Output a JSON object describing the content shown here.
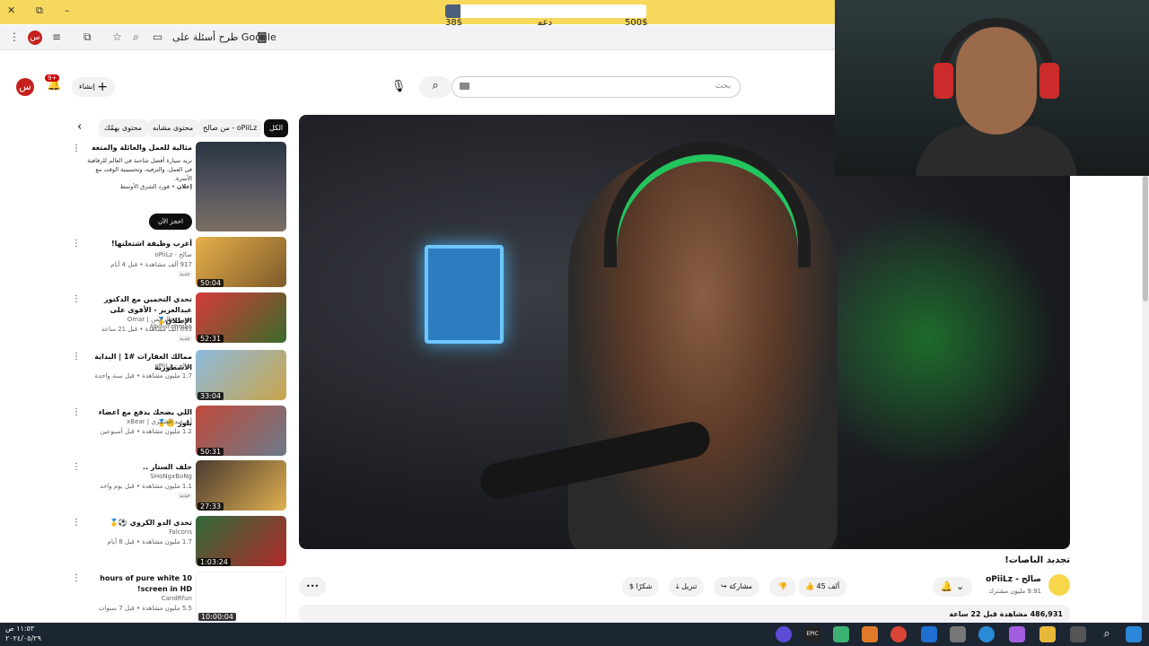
{
  "overlay": {
    "donation": {
      "current": "38$",
      "label": "دعم",
      "goal": "500$",
      "progress": 0.076
    },
    "window_controls": {
      "close": "✕",
      "restore": "⧉",
      "minimize": "–"
    }
  },
  "browser": {
    "search_google": "طرح أسئلة على Google",
    "profile_initial": "س",
    "icons": [
      "menu-dots-icon",
      "reading-list-icon",
      "extensions-icon",
      "star-icon",
      "zoom-icon",
      "install-icon",
      "camera-icon"
    ]
  },
  "youtube": {
    "search_placeholder": "بحث",
    "create_label": "إنشاء",
    "notification_badge": "9+",
    "avatar_initial": "س",
    "chips": [
      "الكل",
      "من صالح - oPiiLz",
      "محتوى مشابه",
      "محتوى يهمّك"
    ],
    "ad": {
      "title": "مثالية للعمل والعائلة والمتعة",
      "description": "تريد سيارة أفضل شاحنة في العالم للرفاهية في العمل، والترفيه، وتحسينية الوقت مع الأسرة.",
      "sponsor_tag": "إعلان",
      "sponsor": "فورد الشرق الأوسط",
      "cta": "احجز الآن"
    },
    "recommendations": [
      {
        "title": "أغرب وظيفة اشتغلتها!",
        "channel": "صالح - oPiiLz",
        "meta": "917 ألف مشاهدة • قبل 4 أيام",
        "new": "جديد",
        "duration": "50:04"
      },
      {
        "title": "تحدي التخمين مع الدكتور عبدالعزيز - الأقوى على الإطلاق🥇",
        "channel": "عمر عبدالرحمن | Omar Abdulrahman",
        "meta": "693 ألف مشاهدة • قبل 21 ساعة",
        "new": "جديد",
        "duration": "52:31"
      },
      {
        "title": "ممالك العقارات #1 | البداية الاسطورية",
        "channel": "صالح - oPiiLz",
        "meta": "1.7 مليون مشاهدة • قبل سنة واحدة",
        "new": "",
        "duration": "33:04"
      },
      {
        "title": "اللي يضحك يدفع مع اعضاء بلور 🤫🥇",
        "channel": "أبو عبد الشمري | xBear",
        "meta": "1.2 مليون مشاهدة • قبل أسبوعين",
        "new": "",
        "duration": "50:31"
      },
      {
        "title": "خلف الستار ..",
        "channel": "SHoNgxBoNg",
        "meta": "1.1 مليون مشاهدة • قبل يوم واحد",
        "new": "جديد",
        "duration": "27:33"
      },
      {
        "title": "تحدي الدو الكروي ⚽🥇",
        "channel": "Falcons",
        "meta": "1.7 مليون مشاهدة • قبل 8 أيام",
        "new": "",
        "duration": "1:03:24"
      },
      {
        "title": "10 hours of pure white screen in HD!",
        "channel": "CandRfun",
        "meta": "5.5 مليون مشاهدة • قبل 7 سنوات",
        "new": "",
        "duration": "10:00:04"
      }
    ],
    "video": {
      "title": "تجديد الباصات!",
      "channel": "صالح - oPiiLz",
      "subscribers": "9.91 مليون مشترك",
      "likes": "45 ألف",
      "share": "مشاركة",
      "download": "تنزيل",
      "thanks": "شكرًا",
      "more": "•••",
      "views": "486,931",
      "views_label": "مشاهدة",
      "time": "قبل 22 ساعة"
    }
  },
  "taskbar": {
    "time": "١١:٥٣ ص",
    "date": "٢٠٢٤/٠٥/٢٩",
    "app_labels": [
      "EPIC"
    ]
  }
}
